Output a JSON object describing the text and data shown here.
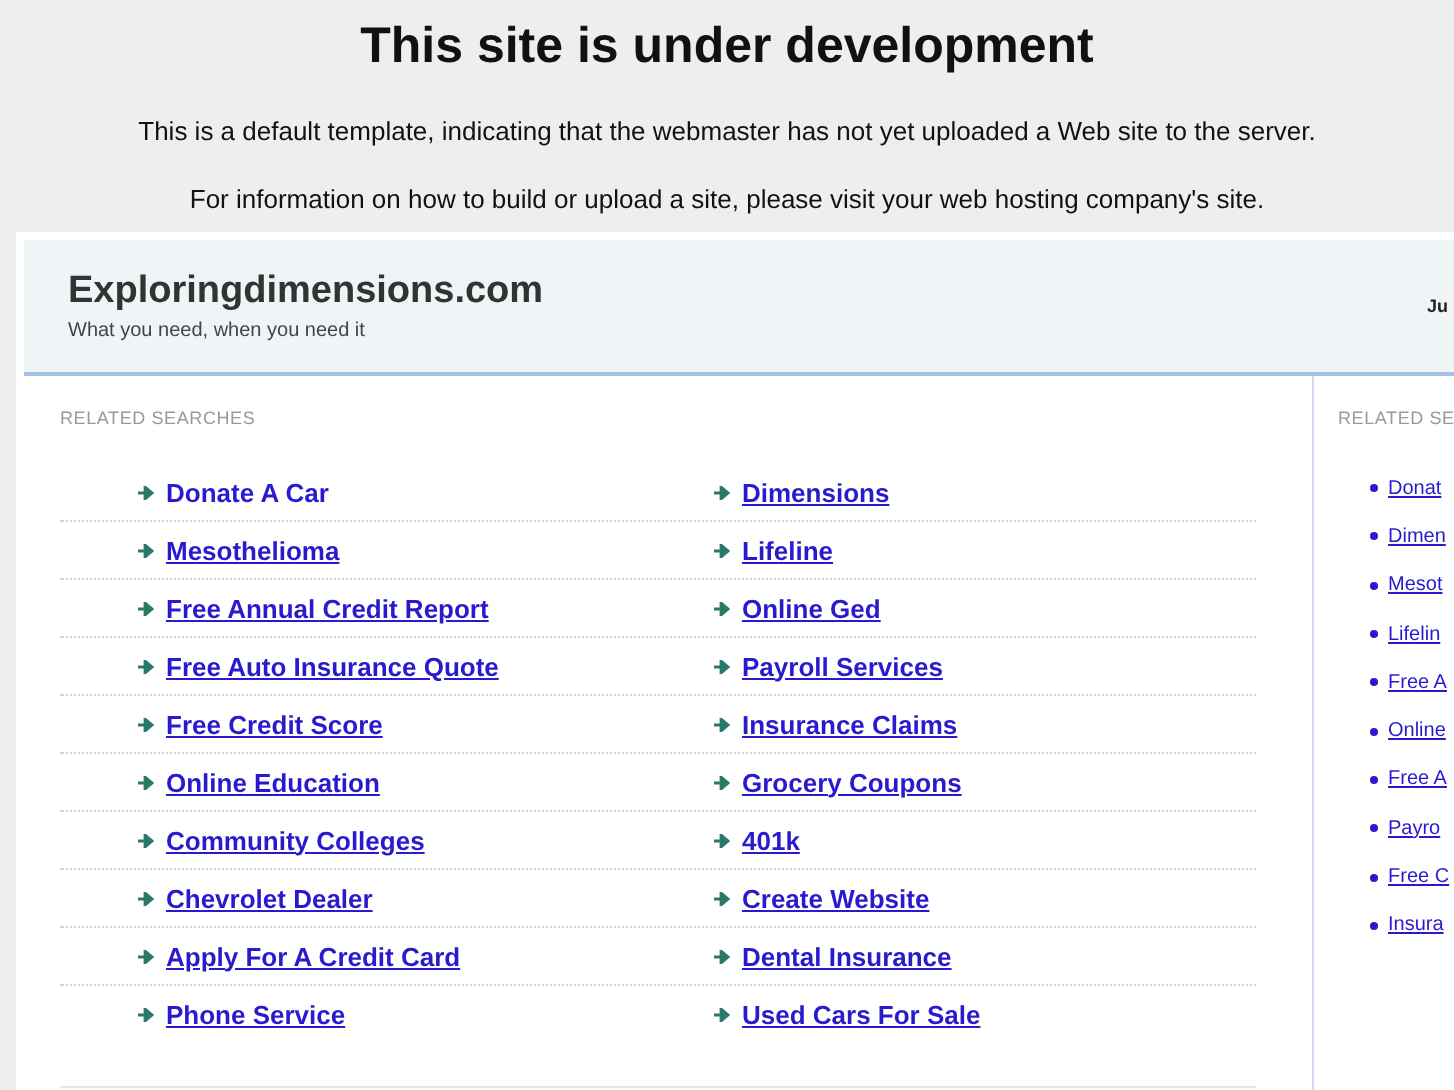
{
  "notice": {
    "title": "This site is under development",
    "lines": [
      "This is a default template, indicating that the webmaster has not yet uploaded a Web site to the server.",
      "For information on how to build or upload a site, please visit your web hosting company's site."
    ]
  },
  "site": {
    "name": "Exploringdimensions.com",
    "tagline": "What you need, when you need it",
    "header_right": "Ju"
  },
  "main": {
    "heading": "RELATED SEARCHES",
    "rows": [
      {
        "left": {
          "label": "Donate A Car",
          "underlined": false
        },
        "right": {
          "label": "Dimensions",
          "underlined": true
        }
      },
      {
        "left": {
          "label": "Mesothelioma",
          "underlined": true
        },
        "right": {
          "label": "Lifeline",
          "underlined": true
        }
      },
      {
        "left": {
          "label": "Free Annual Credit Report",
          "underlined": true
        },
        "right": {
          "label": "Online Ged",
          "underlined": true
        }
      },
      {
        "left": {
          "label": "Free Auto Insurance Quote",
          "underlined": true
        },
        "right": {
          "label": "Payroll Services",
          "underlined": true
        }
      },
      {
        "left": {
          "label": "Free Credit Score",
          "underlined": true
        },
        "right": {
          "label": "Insurance Claims",
          "underlined": true
        }
      },
      {
        "left": {
          "label": "Online Education",
          "underlined": true
        },
        "right": {
          "label": "Grocery Coupons",
          "underlined": true
        }
      },
      {
        "left": {
          "label": "Community Colleges",
          "underlined": true
        },
        "right": {
          "label": "401k",
          "underlined": true
        }
      },
      {
        "left": {
          "label": "Chevrolet Dealer",
          "underlined": true
        },
        "right": {
          "label": "Create Website",
          "underlined": true
        }
      },
      {
        "left": {
          "label": "Apply For A Credit Card",
          "underlined": true
        },
        "right": {
          "label": "Dental Insurance",
          "underlined": true
        }
      },
      {
        "left": {
          "label": "Phone Service",
          "underlined": true
        },
        "right": {
          "label": "Used Cars For Sale",
          "underlined": true
        }
      }
    ]
  },
  "sidebar": {
    "heading": "RELATED SE",
    "items": [
      "Donat",
      "Dimen",
      "Mesot",
      "Lifelin",
      "Free A",
      "Online",
      "Free A",
      "Payro",
      "Free C",
      "Insura"
    ]
  }
}
